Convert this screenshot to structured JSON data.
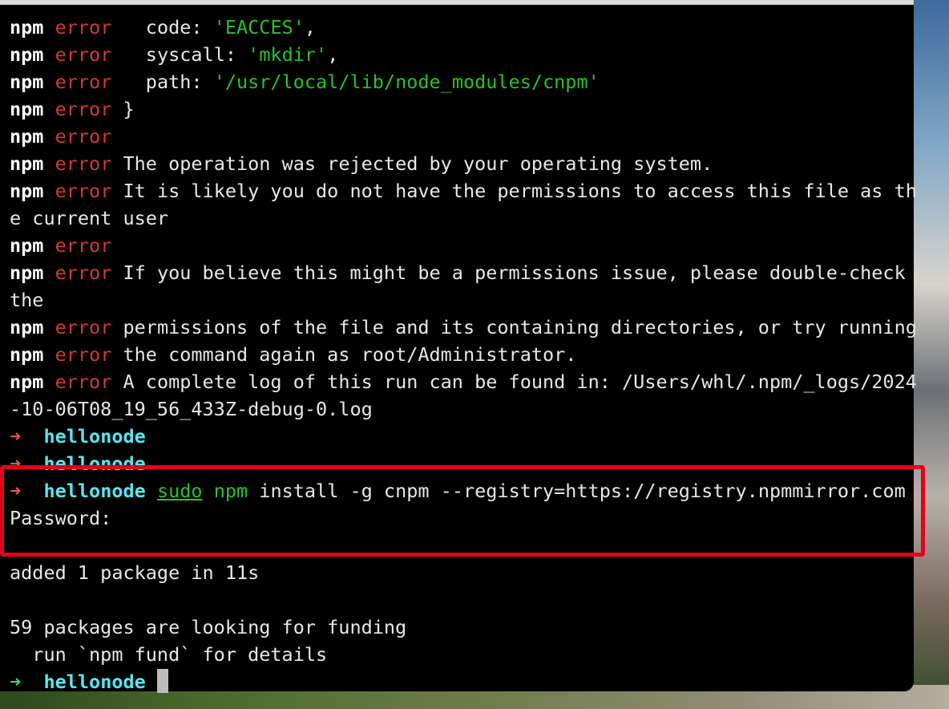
{
  "terminal": {
    "prefix_npm": "npm",
    "prefix_error": "error",
    "prompt_dir": "hellonode",
    "arrow": "➜",
    "lines": {
      "l1": "   code: ",
      "l1_val": "'EACCES'",
      "l1_end": ",",
      "l2": "   syscall: ",
      "l2_val": "'mkdir'",
      "l2_end": ",",
      "l3": "   path: ",
      "l3_val": "'/usr/local/lib/node_modules/cnpm'",
      "l4": " }",
      "l6": " The operation was rejected by your operating system.",
      "l7": " It is likely you do not have the permissions to access this file as th",
      "l7b": "e current user",
      "l9": " If you believe this might be a permissions issue, please double-check",
      "l9b": "the",
      "l10": " permissions of the file and its containing directories, or try running",
      "l11": " the command again as root/Administrator.",
      "l12": " A complete log of this run can be found in: /Users/whl/.npm/_logs/2024",
      "l12b": "-10-06T08_19_56_433Z-debug-0.log"
    },
    "command": {
      "sudo": "sudo",
      "npm": "npm",
      "args": " install -g cnpm --registry=https://registry.npmmirror.com"
    },
    "password_prompt": "Password:",
    "added": "added 1 package in 11s",
    "funding": "59 packages are looking for funding",
    "fund_hint": "  run `npm fund` for details"
  },
  "colors": {
    "highlight": "#e5001b",
    "error": "#d23a2a",
    "string": "#27c22a",
    "directory": "#58e6f0"
  }
}
